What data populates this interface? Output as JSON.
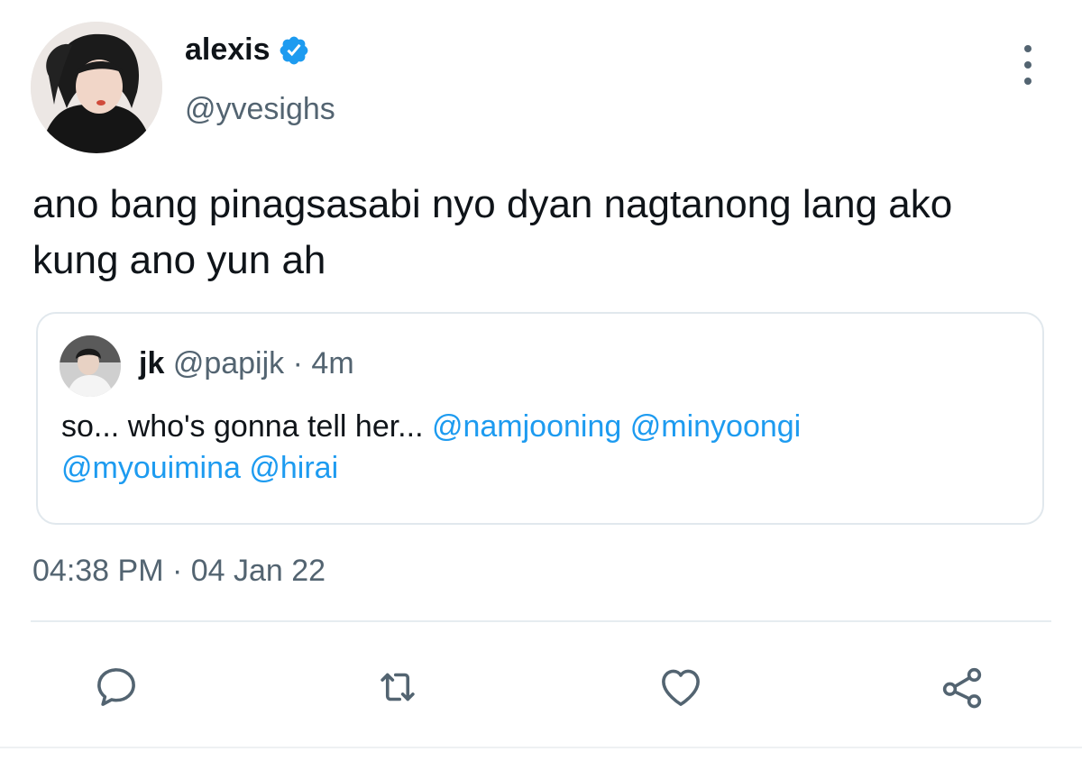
{
  "author": {
    "display_name": "alexis",
    "handle": "@yvesighs",
    "verified_icon": "verified-badge-icon"
  },
  "tweet": {
    "text": "ano bang pinagsasabi nyo dyan nagtanong lang ako kung ano yun ah",
    "timestamp": "04:38 PM · 04 Jan 22"
  },
  "quoted": {
    "name": "jk",
    "handle": "@papijk",
    "separator": "·",
    "time": "4m",
    "text_prefix": "so... who's gonna tell her... ",
    "mentions": [
      "@namjooning",
      "@minyoongi",
      "@myouimina",
      "@hirai"
    ]
  },
  "actions": {
    "icons": [
      "reply-icon",
      "retweet-icon",
      "like-icon",
      "share-icon"
    ]
  },
  "colors": {
    "accent": "#1d9bf0",
    "secondary_text": "#536471",
    "border": "#e1e8ed"
  }
}
